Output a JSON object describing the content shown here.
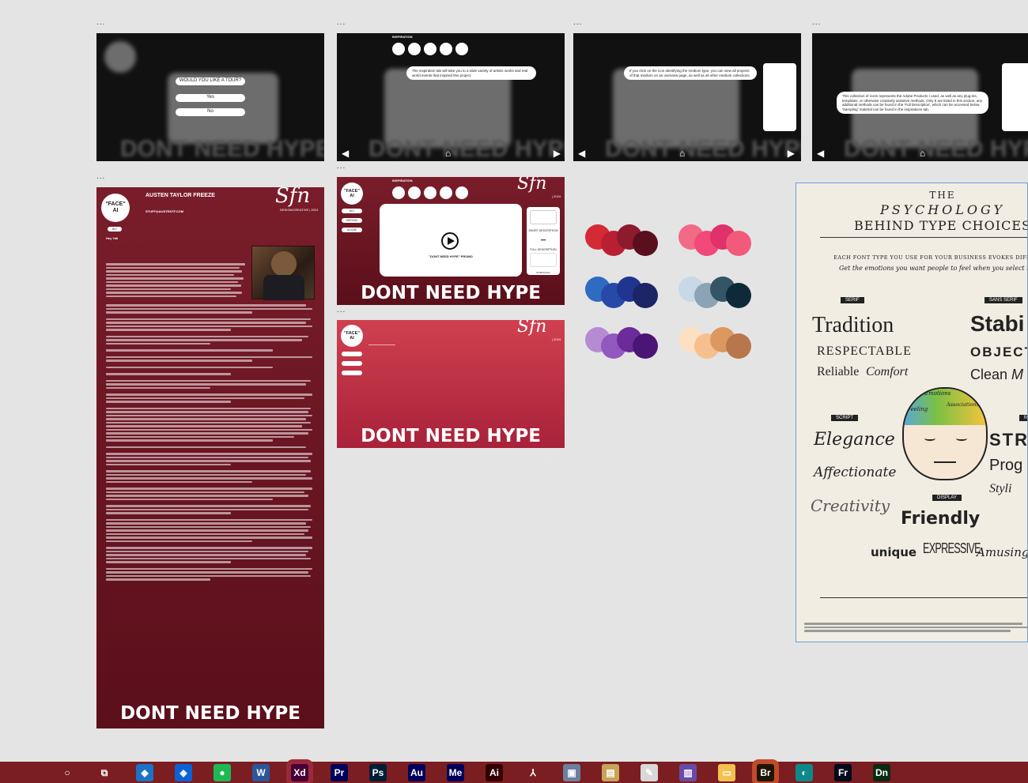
{
  "canvas": {
    "artboard_menu": "...",
    "small_marker": "..."
  },
  "tour_board": {
    "question": "WOULD YOU LIKE A TOUR?",
    "yes": "Yes",
    "no": "No",
    "blur_word": "DONT NEED HYPE"
  },
  "tour_step1": {
    "label": "INSPIRATION",
    "bubble": "The inspiration tab will take you to a wide variety of artistic works and real world events that inspired this project."
  },
  "tour_step2": {
    "bubble": "If you click on the icon identifying the medium type, you can view all projects of that medium on an overview page, as well as all other medium collections."
  },
  "tour_step3": {
    "bubble": "This collection of icons represents the Adobe Products I used, as well as any plug-ins, templates, or otherwise creatively assistive methods. Only 5 are listed in this section, any additional methods can be found in the 'Full Description', which can be accessed below. 'Sampling' material can be found in the inspirations tab."
  },
  "about_board": {
    "logo_line1": "\"FACE\"",
    "logo_line2": "AI",
    "logo_btn": "BIO",
    "name": "AUSTEN TAYLOR FREEZE",
    "email": "STUFF@AUSTENTF.COM",
    "greeting": "Hey Yall",
    "signature": "Sfn",
    "sig_sub": "DESIGN/CREATIVE | 2024",
    "footer": "DONT NEED HYPE"
  },
  "project_board": {
    "logo_line1": "\"FACE\"",
    "logo_line2": "AI",
    "label": "INSPIRATION",
    "side_btns": [
      "BIO",
      "MEDIUM",
      "ADOBE"
    ],
    "video_caption": "\"DONT NEED HYPE\" PROMO",
    "panel_text1": "SHORT DESCRIPTION",
    "panel_text2": "FULL DESCRIPTION",
    "panel_label": "PORTFOLIO",
    "signature": "Sfn",
    "sig_sub": "| 2024",
    "footer": "DONT NEED HYPE"
  },
  "blank_board": {
    "logo_line1": "\"FACE\"",
    "logo_line2": "AI",
    "signature": "Sfn",
    "sig_sub": "| 2024",
    "footer": "DONT NEED HYPE"
  },
  "palettes": [
    [
      "#d42a36",
      "#b91f33",
      "#8e1a2e",
      "#5a0f1e"
    ],
    [
      "#f26b86",
      "#f0497a",
      "#e0316a",
      "#f25a7c"
    ],
    [
      "#2f6bc1",
      "#2749a8",
      "#1f3590",
      "#1c2565"
    ],
    [
      "#c7d8e6",
      "#8aa3b5",
      "#335566",
      "#0e2a38"
    ],
    [
      "#b58cd2",
      "#9159c0",
      "#6b2b9a",
      "#4a1575"
    ],
    [
      "#fde0c2",
      "#f7bf8d",
      "#dc9860",
      "#b8764c"
    ]
  ],
  "poster": {
    "the": "THE",
    "title1": "PSYCHOLOGY",
    "title2": "BEHIND TYPE CHOICES",
    "sub1": "EACH FONT TYPE YOU USE FOR YOUR BUSINESS EVOKES DIFFERENT",
    "sub2": "Get the emotions you want people to feel when you select the right l",
    "serif_label": "SERIF",
    "sans_label": "SANS SERIF",
    "script_label": "SCRIPT",
    "display_label": "DISPLAY",
    "modern_label": "MO",
    "serif_words": [
      "Tradition",
      "RESPECTABLE",
      "Reliable",
      "Comfort"
    ],
    "sans_words": [
      "Stabi",
      "OBJECT",
      "Clean",
      "M"
    ],
    "script_words": [
      "Elegance",
      "Affectionate",
      "Creativity"
    ],
    "modern_words": [
      "STR",
      "Prog",
      "Styli"
    ],
    "display_words": [
      "Friendly",
      "unique",
      "EXPRESSIVE",
      "Amusing"
    ],
    "brain_words": [
      "Emotions",
      "Feeling",
      "Associations"
    ]
  },
  "taskbar": {
    "icons": [
      {
        "name": "search",
        "glyph": "○",
        "bg": "transparent"
      },
      {
        "name": "task-view",
        "glyph": "⧉",
        "bg": "transparent"
      },
      {
        "name": "edge-legacy",
        "glyph": "◆",
        "bg": "#1a73c8"
      },
      {
        "name": "dropbox",
        "glyph": "◈",
        "bg": "#0b62d6"
      },
      {
        "name": "spotify",
        "glyph": "●",
        "bg": "#1db954"
      },
      {
        "name": "word",
        "glyph": "W",
        "bg": "#2b579a"
      },
      {
        "name": "xd",
        "glyph": "Xd",
        "bg": "#470137"
      },
      {
        "name": "premiere",
        "glyph": "Pr",
        "bg": "#00005b"
      },
      {
        "name": "photoshop",
        "glyph": "Ps",
        "bg": "#001e36"
      },
      {
        "name": "audition",
        "glyph": "Au",
        "bg": "#00005b"
      },
      {
        "name": "media-encoder",
        "glyph": "Me",
        "bg": "#00005b"
      },
      {
        "name": "illustrator",
        "glyph": "Ai",
        "bg": "#330000"
      },
      {
        "name": "acrobat",
        "glyph": "⅄",
        "bg": "transparent"
      },
      {
        "name": "photos",
        "glyph": "▣",
        "bg": "#6e7fa0"
      },
      {
        "name": "files",
        "glyph": "▤",
        "bg": "#c7a45a"
      },
      {
        "name": "paint",
        "glyph": "✎",
        "bg": "#d8d8d8"
      },
      {
        "name": "winrar",
        "glyph": "▥",
        "bg": "#6a4aa8"
      },
      {
        "name": "explorer",
        "glyph": "▭",
        "bg": "#f2c14e"
      },
      {
        "name": "bridge",
        "glyph": "Br",
        "bg": "#1e1500"
      },
      {
        "name": "edge",
        "glyph": "◐",
        "bg": "#0c8a8a"
      },
      {
        "name": "fresco",
        "glyph": "Fr",
        "bg": "#000b1d"
      },
      {
        "name": "dimension",
        "glyph": "Dn",
        "bg": "#0a2a12"
      }
    ]
  }
}
